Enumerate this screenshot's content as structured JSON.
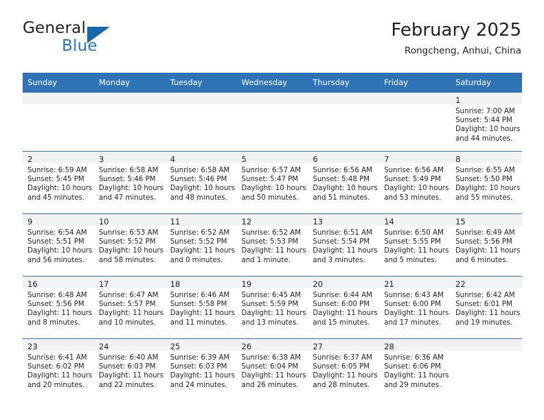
{
  "brand": {
    "name_part1": "General",
    "name_part2": "Blue",
    "logo_icon": "blue-triangle-flag"
  },
  "header": {
    "title": "February 2025",
    "subtitle": "Rongcheng, Anhui, China"
  },
  "colors": {
    "header_blue": "#2e74b5",
    "daynum_band": "#f2f2f2",
    "brand_blue": "#1f78c1",
    "text": "#231f20"
  },
  "weekday_headers": [
    "Sunday",
    "Monday",
    "Tuesday",
    "Wednesday",
    "Thursday",
    "Friday",
    "Saturday"
  ],
  "weeks": [
    [
      {
        "day": "",
        "sunrise": "",
        "sunset": "",
        "daylight1": "",
        "daylight2": ""
      },
      {
        "day": "",
        "sunrise": "",
        "sunset": "",
        "daylight1": "",
        "daylight2": ""
      },
      {
        "day": "",
        "sunrise": "",
        "sunset": "",
        "daylight1": "",
        "daylight2": ""
      },
      {
        "day": "",
        "sunrise": "",
        "sunset": "",
        "daylight1": "",
        "daylight2": ""
      },
      {
        "day": "",
        "sunrise": "",
        "sunset": "",
        "daylight1": "",
        "daylight2": ""
      },
      {
        "day": "",
        "sunrise": "",
        "sunset": "",
        "daylight1": "",
        "daylight2": ""
      },
      {
        "day": "1",
        "sunrise": "Sunrise: 7:00 AM",
        "sunset": "Sunset: 5:44 PM",
        "daylight1": "Daylight: 10 hours",
        "daylight2": "and 44 minutes."
      }
    ],
    [
      {
        "day": "2",
        "sunrise": "Sunrise: 6:59 AM",
        "sunset": "Sunset: 5:45 PM",
        "daylight1": "Daylight: 10 hours",
        "daylight2": "and 45 minutes."
      },
      {
        "day": "3",
        "sunrise": "Sunrise: 6:58 AM",
        "sunset": "Sunset: 5:46 PM",
        "daylight1": "Daylight: 10 hours",
        "daylight2": "and 47 minutes."
      },
      {
        "day": "4",
        "sunrise": "Sunrise: 6:58 AM",
        "sunset": "Sunset: 5:46 PM",
        "daylight1": "Daylight: 10 hours",
        "daylight2": "and 48 minutes."
      },
      {
        "day": "5",
        "sunrise": "Sunrise: 6:57 AM",
        "sunset": "Sunset: 5:47 PM",
        "daylight1": "Daylight: 10 hours",
        "daylight2": "and 50 minutes."
      },
      {
        "day": "6",
        "sunrise": "Sunrise: 6:56 AM",
        "sunset": "Sunset: 5:48 PM",
        "daylight1": "Daylight: 10 hours",
        "daylight2": "and 51 minutes."
      },
      {
        "day": "7",
        "sunrise": "Sunrise: 6:56 AM",
        "sunset": "Sunset: 5:49 PM",
        "daylight1": "Daylight: 10 hours",
        "daylight2": "and 53 minutes."
      },
      {
        "day": "8",
        "sunrise": "Sunrise: 6:55 AM",
        "sunset": "Sunset: 5:50 PM",
        "daylight1": "Daylight: 10 hours",
        "daylight2": "and 55 minutes."
      }
    ],
    [
      {
        "day": "9",
        "sunrise": "Sunrise: 6:54 AM",
        "sunset": "Sunset: 5:51 PM",
        "daylight1": "Daylight: 10 hours",
        "daylight2": "and 56 minutes."
      },
      {
        "day": "10",
        "sunrise": "Sunrise: 6:53 AM",
        "sunset": "Sunset: 5:52 PM",
        "daylight1": "Daylight: 10 hours",
        "daylight2": "and 58 minutes."
      },
      {
        "day": "11",
        "sunrise": "Sunrise: 6:52 AM",
        "sunset": "Sunset: 5:52 PM",
        "daylight1": "Daylight: 11 hours",
        "daylight2": "and 0 minutes."
      },
      {
        "day": "12",
        "sunrise": "Sunrise: 6:52 AM",
        "sunset": "Sunset: 5:53 PM",
        "daylight1": "Daylight: 11 hours",
        "daylight2": "and 1 minute."
      },
      {
        "day": "13",
        "sunrise": "Sunrise: 6:51 AM",
        "sunset": "Sunset: 5:54 PM",
        "daylight1": "Daylight: 11 hours",
        "daylight2": "and 3 minutes."
      },
      {
        "day": "14",
        "sunrise": "Sunrise: 6:50 AM",
        "sunset": "Sunset: 5:55 PM",
        "daylight1": "Daylight: 11 hours",
        "daylight2": "and 5 minutes."
      },
      {
        "day": "15",
        "sunrise": "Sunrise: 6:49 AM",
        "sunset": "Sunset: 5:56 PM",
        "daylight1": "Daylight: 11 hours",
        "daylight2": "and 6 minutes."
      }
    ],
    [
      {
        "day": "16",
        "sunrise": "Sunrise: 6:48 AM",
        "sunset": "Sunset: 5:56 PM",
        "daylight1": "Daylight: 11 hours",
        "daylight2": "and 8 minutes."
      },
      {
        "day": "17",
        "sunrise": "Sunrise: 6:47 AM",
        "sunset": "Sunset: 5:57 PM",
        "daylight1": "Daylight: 11 hours",
        "daylight2": "and 10 minutes."
      },
      {
        "day": "18",
        "sunrise": "Sunrise: 6:46 AM",
        "sunset": "Sunset: 5:58 PM",
        "daylight1": "Daylight: 11 hours",
        "daylight2": "and 11 minutes."
      },
      {
        "day": "19",
        "sunrise": "Sunrise: 6:45 AM",
        "sunset": "Sunset: 5:59 PM",
        "daylight1": "Daylight: 11 hours",
        "daylight2": "and 13 minutes."
      },
      {
        "day": "20",
        "sunrise": "Sunrise: 6:44 AM",
        "sunset": "Sunset: 6:00 PM",
        "daylight1": "Daylight: 11 hours",
        "daylight2": "and 15 minutes."
      },
      {
        "day": "21",
        "sunrise": "Sunrise: 6:43 AM",
        "sunset": "Sunset: 6:00 PM",
        "daylight1": "Daylight: 11 hours",
        "daylight2": "and 17 minutes."
      },
      {
        "day": "22",
        "sunrise": "Sunrise: 6:42 AM",
        "sunset": "Sunset: 6:01 PM",
        "daylight1": "Daylight: 11 hours",
        "daylight2": "and 19 minutes."
      }
    ],
    [
      {
        "day": "23",
        "sunrise": "Sunrise: 6:41 AM",
        "sunset": "Sunset: 6:02 PM",
        "daylight1": "Daylight: 11 hours",
        "daylight2": "and 20 minutes."
      },
      {
        "day": "24",
        "sunrise": "Sunrise: 6:40 AM",
        "sunset": "Sunset: 6:03 PM",
        "daylight1": "Daylight: 11 hours",
        "daylight2": "and 22 minutes."
      },
      {
        "day": "25",
        "sunrise": "Sunrise: 6:39 AM",
        "sunset": "Sunset: 6:03 PM",
        "daylight1": "Daylight: 11 hours",
        "daylight2": "and 24 minutes."
      },
      {
        "day": "26",
        "sunrise": "Sunrise: 6:38 AM",
        "sunset": "Sunset: 6:04 PM",
        "daylight1": "Daylight: 11 hours",
        "daylight2": "and 26 minutes."
      },
      {
        "day": "27",
        "sunrise": "Sunrise: 6:37 AM",
        "sunset": "Sunset: 6:05 PM",
        "daylight1": "Daylight: 11 hours",
        "daylight2": "and 28 minutes."
      },
      {
        "day": "28",
        "sunrise": "Sunrise: 6:36 AM",
        "sunset": "Sunset: 6:06 PM",
        "daylight1": "Daylight: 11 hours",
        "daylight2": "and 29 minutes."
      },
      {
        "day": "",
        "sunrise": "",
        "sunset": "",
        "daylight1": "",
        "daylight2": ""
      }
    ]
  ]
}
